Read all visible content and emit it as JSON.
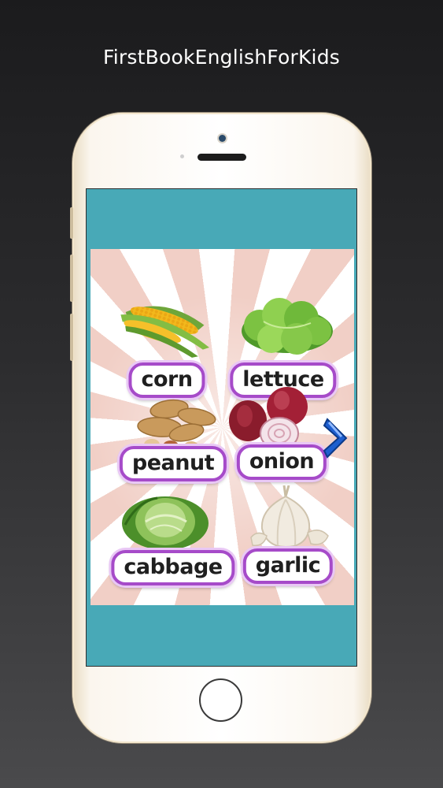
{
  "app": {
    "title": "FirstBookEnglishForKids"
  },
  "items": [
    {
      "word": "corn",
      "icon": "corn-icon"
    },
    {
      "word": "lettuce",
      "icon": "lettuce-icon"
    },
    {
      "word": "peanut",
      "icon": "peanut-icon"
    },
    {
      "word": "onion",
      "icon": "onion-icon"
    },
    {
      "word": "cabbage",
      "icon": "cabbage-icon"
    },
    {
      "word": "garlic",
      "icon": "garlic-icon"
    }
  ],
  "navigation": {
    "next_icon": "chevron-right-icon"
  },
  "colors": {
    "screen_bg": "#48a9b7",
    "label_border": "#a64bc9",
    "arrow": "#1e5fcf"
  }
}
